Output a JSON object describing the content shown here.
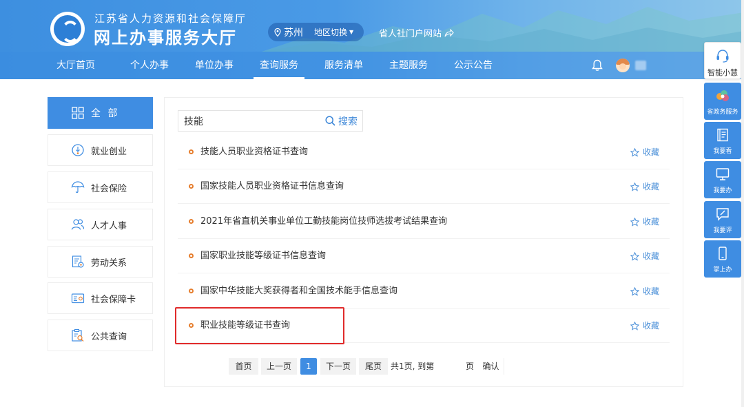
{
  "header": {
    "org_name": "江苏省人力资源和社会保障厅",
    "hall_name": "网上办事服务大厅",
    "city": "苏州",
    "city_switch": "地区切换",
    "portal_link": "省人社门户网站"
  },
  "nav": {
    "items": [
      {
        "label": "大厅首页"
      },
      {
        "label": "个人办事"
      },
      {
        "label": "单位办事"
      },
      {
        "label": "查询服务",
        "active": true
      },
      {
        "label": "服务清单"
      },
      {
        "label": "主题服务"
      },
      {
        "label": "公示公告"
      }
    ]
  },
  "sidebar": {
    "items": [
      {
        "label": "全 部",
        "icon": "grid-icon",
        "active": true
      },
      {
        "label": "就业创业",
        "icon": "medal-icon"
      },
      {
        "label": "社会保险",
        "icon": "umbrella-icon"
      },
      {
        "label": "人才人事",
        "icon": "users-icon"
      },
      {
        "label": "劳动关系",
        "icon": "document-gear-icon"
      },
      {
        "label": "社会保障卡",
        "icon": "card-icon"
      },
      {
        "label": "公共查询",
        "icon": "clipboard-search-icon"
      }
    ]
  },
  "search": {
    "value": "技能",
    "button_label": "搜索"
  },
  "results": {
    "favorite_label": "收藏",
    "items": [
      {
        "title": "技能人员职业资格证书查询"
      },
      {
        "title": "国家技能人员职业资格证书信息查询"
      },
      {
        "title": "2021年省直机关事业单位工勤技能岗位技师选拔考试结果查询"
      },
      {
        "title": "国家职业技能等级证书信息查询"
      },
      {
        "title": "国家中华技能大奖获得者和全国技术能手信息查询"
      },
      {
        "title": "职业技能等级证书查询",
        "highlighted": true
      }
    ]
  },
  "pagination": {
    "first": "首页",
    "prev": "上一页",
    "current": "1",
    "next": "下一页",
    "last": "尾页",
    "summary": "共1页, 到第",
    "page_unit": "页",
    "confirm": "确认"
  },
  "float_tools": {
    "assistant": "智能小慧",
    "items": [
      {
        "label": "省政务服务",
        "icon": "gov-logo-icon"
      },
      {
        "label": "我要看",
        "icon": "book-icon"
      },
      {
        "label": "我要办",
        "icon": "monitor-icon"
      },
      {
        "label": "我要评",
        "icon": "comment-edit-icon"
      },
      {
        "label": "掌上办",
        "icon": "mobile-icon"
      }
    ]
  },
  "colors": {
    "primary": "#3f8de2",
    "accent_dot": "#e67e2e",
    "highlight_border": "#e02a2a",
    "link": "#4a8fd8"
  }
}
